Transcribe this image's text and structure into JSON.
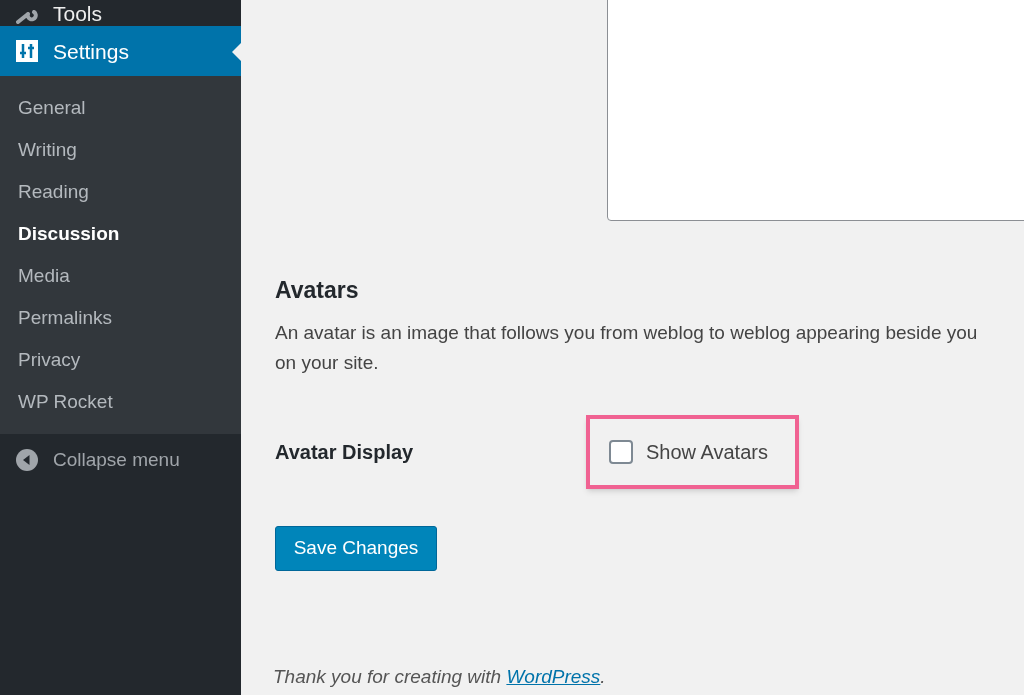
{
  "sidebar": {
    "items": [
      {
        "label": "Tools",
        "selected": false
      },
      {
        "label": "Settings",
        "selected": true,
        "children": [
          {
            "label": "General",
            "selected": false
          },
          {
            "label": "Writing",
            "selected": false
          },
          {
            "label": "Reading",
            "selected": false
          },
          {
            "label": "Discussion",
            "selected": true
          },
          {
            "label": "Media",
            "selected": false
          },
          {
            "label": "Permalinks",
            "selected": false
          },
          {
            "label": "Privacy",
            "selected": false
          },
          {
            "label": "WP Rocket",
            "selected": false
          }
        ]
      }
    ],
    "collapse": "Collapse menu"
  },
  "section": {
    "title": "Avatars",
    "description": "An avatar is an image that follows you from weblog to weblog appearing beside you\non your site.",
    "fields": [
      {
        "label": "Avatar Display",
        "option": "Show Avatars",
        "checked": false,
        "highlighted": true
      }
    ]
  },
  "save_button": "Save Changes",
  "footer": {
    "text": "Thank you for creating with ",
    "link": "WordPress",
    "end": "."
  }
}
